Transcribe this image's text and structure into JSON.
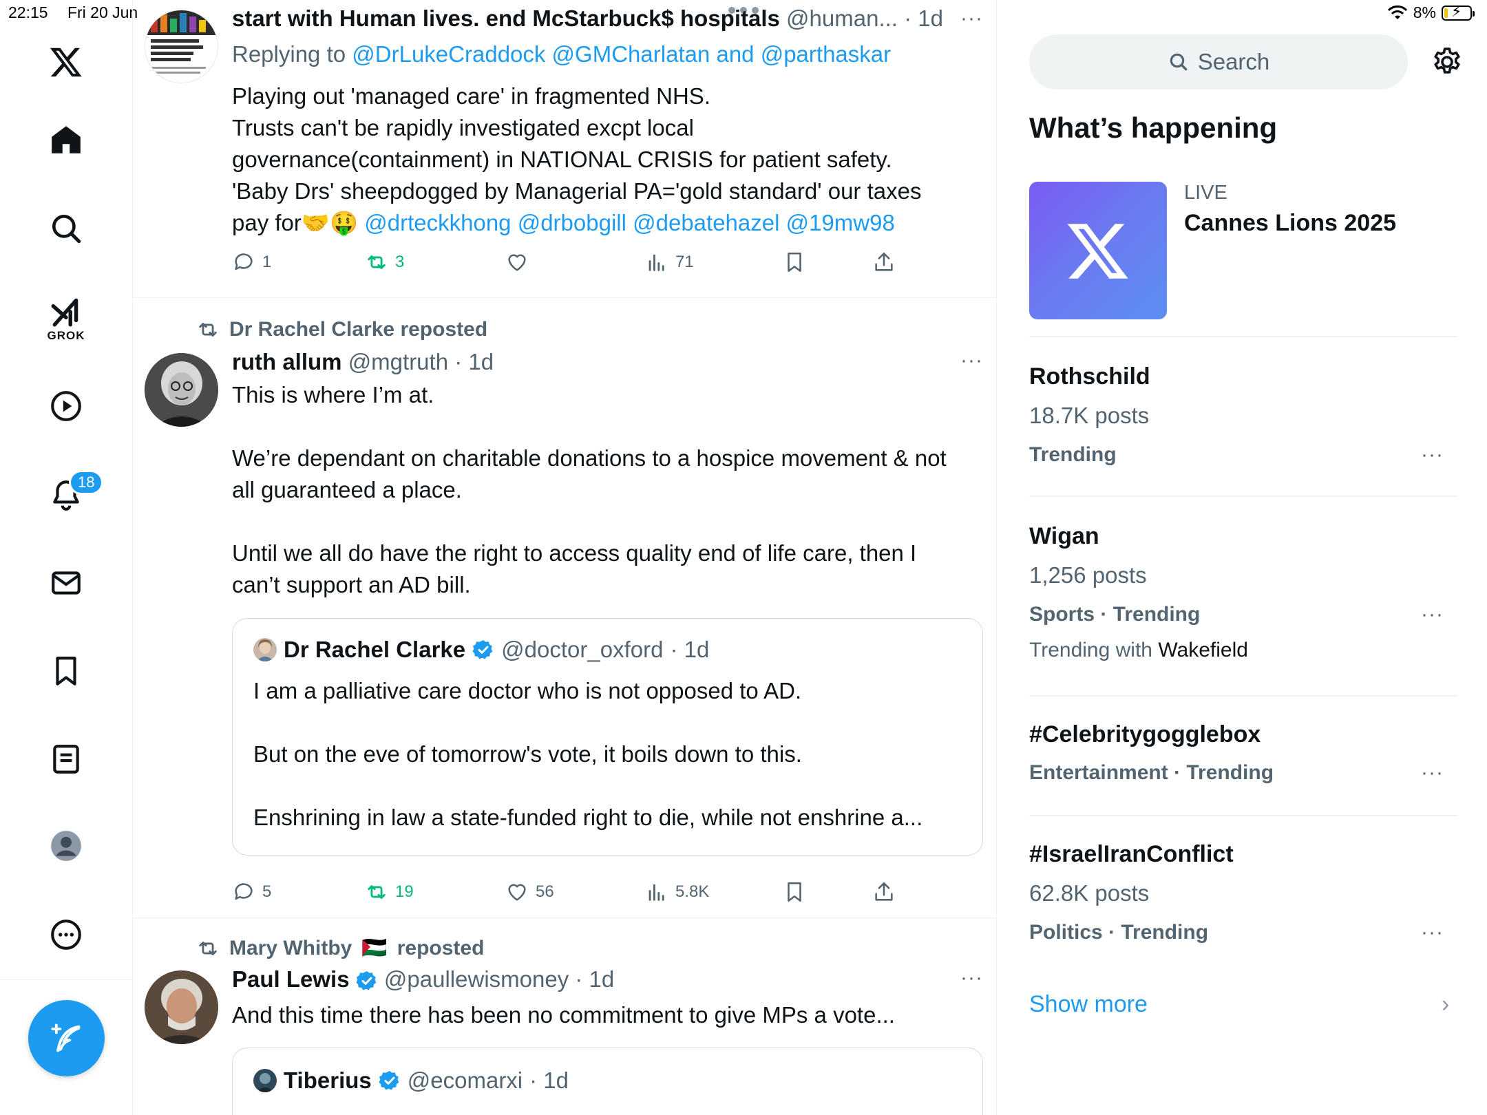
{
  "status": {
    "time": "22:15",
    "date": "Fri 20 Jun",
    "battery": "8%"
  },
  "nav": {
    "items": [
      "x-logo",
      "home",
      "explore",
      "grok",
      "video",
      "notifications",
      "messages",
      "bookmarks",
      "lists",
      "profile",
      "more"
    ],
    "grok_label": "GROK",
    "notifications_badge": "18"
  },
  "timeline": {
    "tweet1": {
      "name": "start with Human lives. end McStarbuck$ hospitals",
      "handle": "@human...",
      "time": "· 1d",
      "replying_label": "Replying to",
      "replying_mentions": "@DrLukeCraddock @GMCharlatan and @parthaskar",
      "line1": "Playing out 'managed care' in fragmented NHS.",
      "line2": "Trusts can't be rapidly investigated excpt local",
      "line3": "governance(containment) in NATIONAL CRISIS for patient safety.",
      "line4": "'Baby Drs' sheepdogged by Managerial PA='gold standard' our taxes",
      "line5_text": "pay for",
      "line5_emoji": "🤝🤑",
      "line5_mentions": "@drteckkhong @drbobgill @debatehazel @19mw98",
      "replies": "1",
      "reposts": "3",
      "likes": "",
      "views": "71",
      "avatar_headline": "How Britain's excess Covid deaths have cut the state pension burden by £1.5bn"
    },
    "tweet2": {
      "reposted_by": "Dr Rachel Clarke reposted",
      "name": "ruth allum",
      "handle": "@mgtruth",
      "time": "· 1d",
      "p1": "This is where I’m at.",
      "p2a": "We’re dependant on charitable donations to a hospice movement & not",
      "p2b": "all guaranteed a place.",
      "p3a": "Until we all do have the right to access quality end of life care, then I",
      "p3b": "can’t support an AD bill.",
      "quote": {
        "name": "Dr Rachel Clarke",
        "handle": "@doctor_oxford",
        "time": "· 1d",
        "p1": "I am a palliative care doctor who is not opposed to AD.",
        "p2": "But on the eve of tomorrow's vote, it boils down to this.",
        "p3": "Enshrining in law a state-funded right to die, while not enshrine a..."
      },
      "replies": "5",
      "reposts": "19",
      "likes": "56",
      "views": "5.8K"
    },
    "tweet3": {
      "reposted_by_name": "Mary Whitby",
      "reposted_flag": "🇵🇸",
      "reposted_suffix": "reposted",
      "name": "Paul Lewis",
      "handle": "@paullewismoney",
      "time": "· 1d",
      "text": "And this time there has been no commitment to give MPs a vote...",
      "quote": {
        "name": "Tiberius",
        "handle": "@ecomarxi",
        "time": "· 1d"
      }
    }
  },
  "sidebar": {
    "search_placeholder": "Search",
    "section_title": "What’s happening",
    "live": {
      "label": "LIVE",
      "title": "Cannes Lions 2025"
    },
    "trends": [
      {
        "name": "Rothschild",
        "count": "18.7K posts",
        "category": "Trending"
      },
      {
        "name": "Wigan",
        "count": "1,256 posts",
        "category": "Sports · Trending",
        "with_label": "Trending with",
        "with_value": "Wakefield"
      },
      {
        "name": "#Celebritygogglebox",
        "category": "Entertainment · Trending"
      },
      {
        "name": "#IsraelIranConflict",
        "count": "62.8K posts",
        "category": "Politics · Trending"
      }
    ],
    "show_more": "Show more",
    "more_dots": "···"
  },
  "colors": {
    "accent": "#1d9bf0",
    "repost_green": "#00ba7c",
    "secondary_text": "#536471"
  }
}
